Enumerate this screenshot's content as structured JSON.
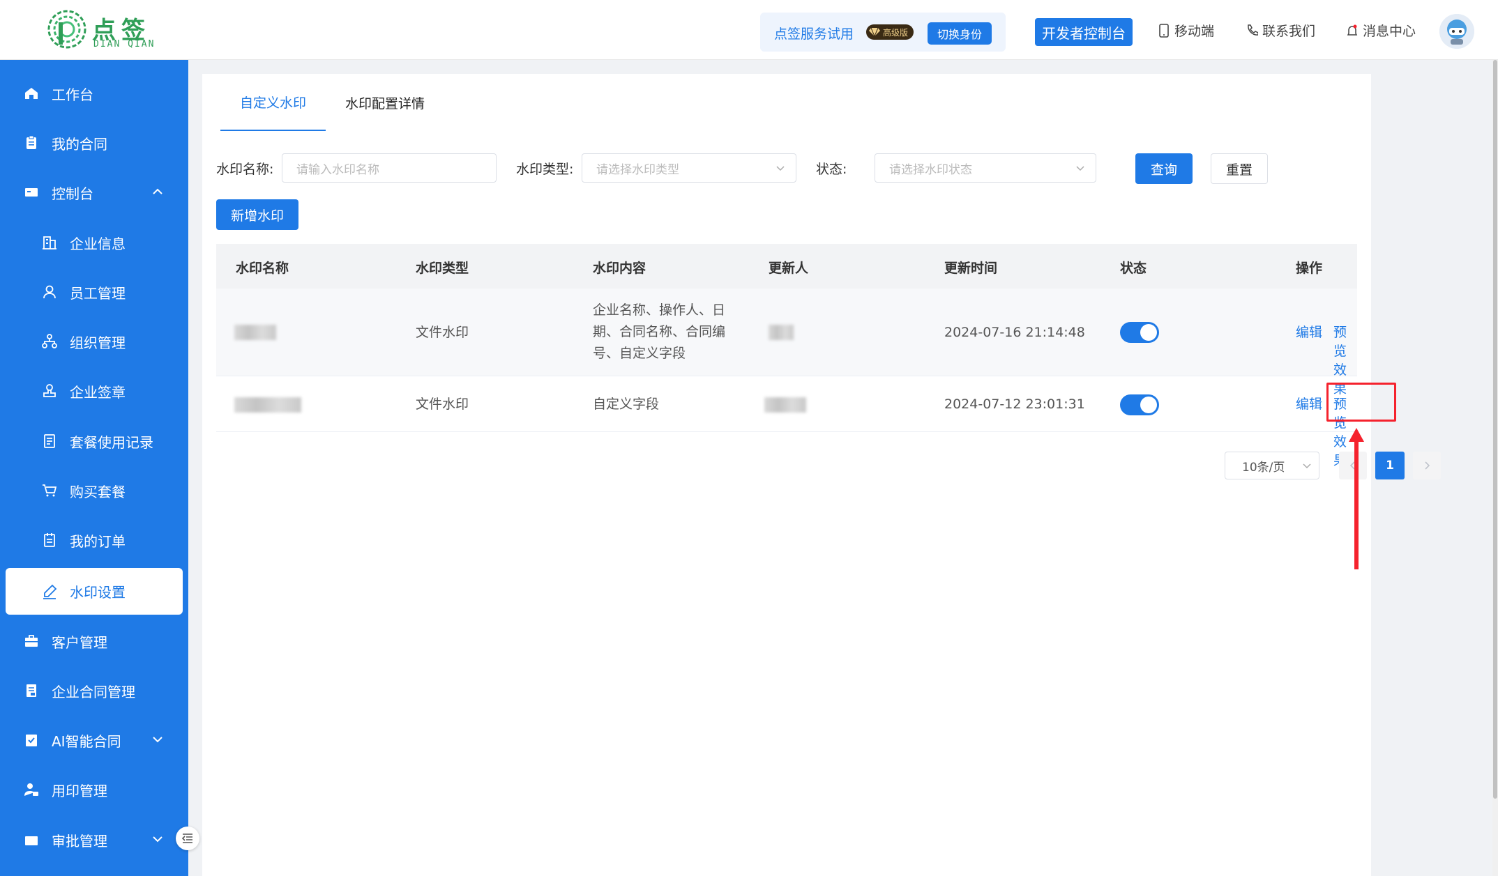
{
  "header": {
    "logo_cn": "点签",
    "logo_en": "DIAN QIAN",
    "trial_text": "点签服务试用",
    "vip_badge": "高级版",
    "switch_identity": "切换身份",
    "dev_console": "开发者控制台",
    "mobile": "移动端",
    "contact": "联系我们",
    "messages": "消息中心"
  },
  "sidebar": {
    "items": [
      {
        "label": "工作台",
        "icon": "home-icon"
      },
      {
        "label": "我的合同",
        "icon": "clipboard-icon"
      },
      {
        "label": "控制台",
        "icon": "console-icon"
      },
      {
        "label": "企业信息",
        "icon": "building-icon"
      },
      {
        "label": "员工管理",
        "icon": "user-icon"
      },
      {
        "label": "组织管理",
        "icon": "org-icon"
      },
      {
        "label": "企业签章",
        "icon": "stamp-icon"
      },
      {
        "label": "套餐使用记录",
        "icon": "record-icon"
      },
      {
        "label": "购买套餐",
        "icon": "cart-icon"
      },
      {
        "label": "我的订单",
        "icon": "order-icon"
      },
      {
        "label": "水印设置",
        "icon": "pen-icon"
      },
      {
        "label": "客户管理",
        "icon": "briefcase-icon"
      },
      {
        "label": "企业合同管理",
        "icon": "contract-icon"
      },
      {
        "label": "AI智能合同",
        "icon": "ai-contract-icon"
      },
      {
        "label": "用印管理",
        "icon": "seal-user-icon"
      },
      {
        "label": "审批管理",
        "icon": "approval-icon"
      }
    ]
  },
  "tabs": [
    "自定义水印",
    "水印配置详情"
  ],
  "filters": {
    "name_label": "水印名称:",
    "name_placeholder": "请输入水印名称",
    "type_label": "水印类型:",
    "type_placeholder": "请选择水印类型",
    "status_label": "状态:",
    "status_placeholder": "请选择水印状态",
    "query": "查询",
    "reset": "重置",
    "add": "新增水印"
  },
  "table": {
    "columns": [
      "水印名称",
      "水印类型",
      "水印内容",
      "更新人",
      "更新时间",
      "状态",
      "操作"
    ],
    "rows": [
      {
        "type": "文件水印",
        "content": "企业名称、操作人、日期、合同名称、合同编号、自定义字段",
        "time": "2024-07-16 21:14:48",
        "status_on": true,
        "edit": "编辑",
        "preview": "预览效果"
      },
      {
        "type": "文件水印",
        "content": "自定义字段",
        "time": "2024-07-12 23:01:31",
        "status_on": true,
        "edit": "编辑",
        "preview": "预览效果"
      }
    ]
  },
  "pagination": {
    "page_size": "10条/页",
    "current_page": "1"
  },
  "colors": {
    "primary": "#1f7ae6",
    "sidebar_bg": "#1f7ae6",
    "highlight": "#f5222d"
  }
}
